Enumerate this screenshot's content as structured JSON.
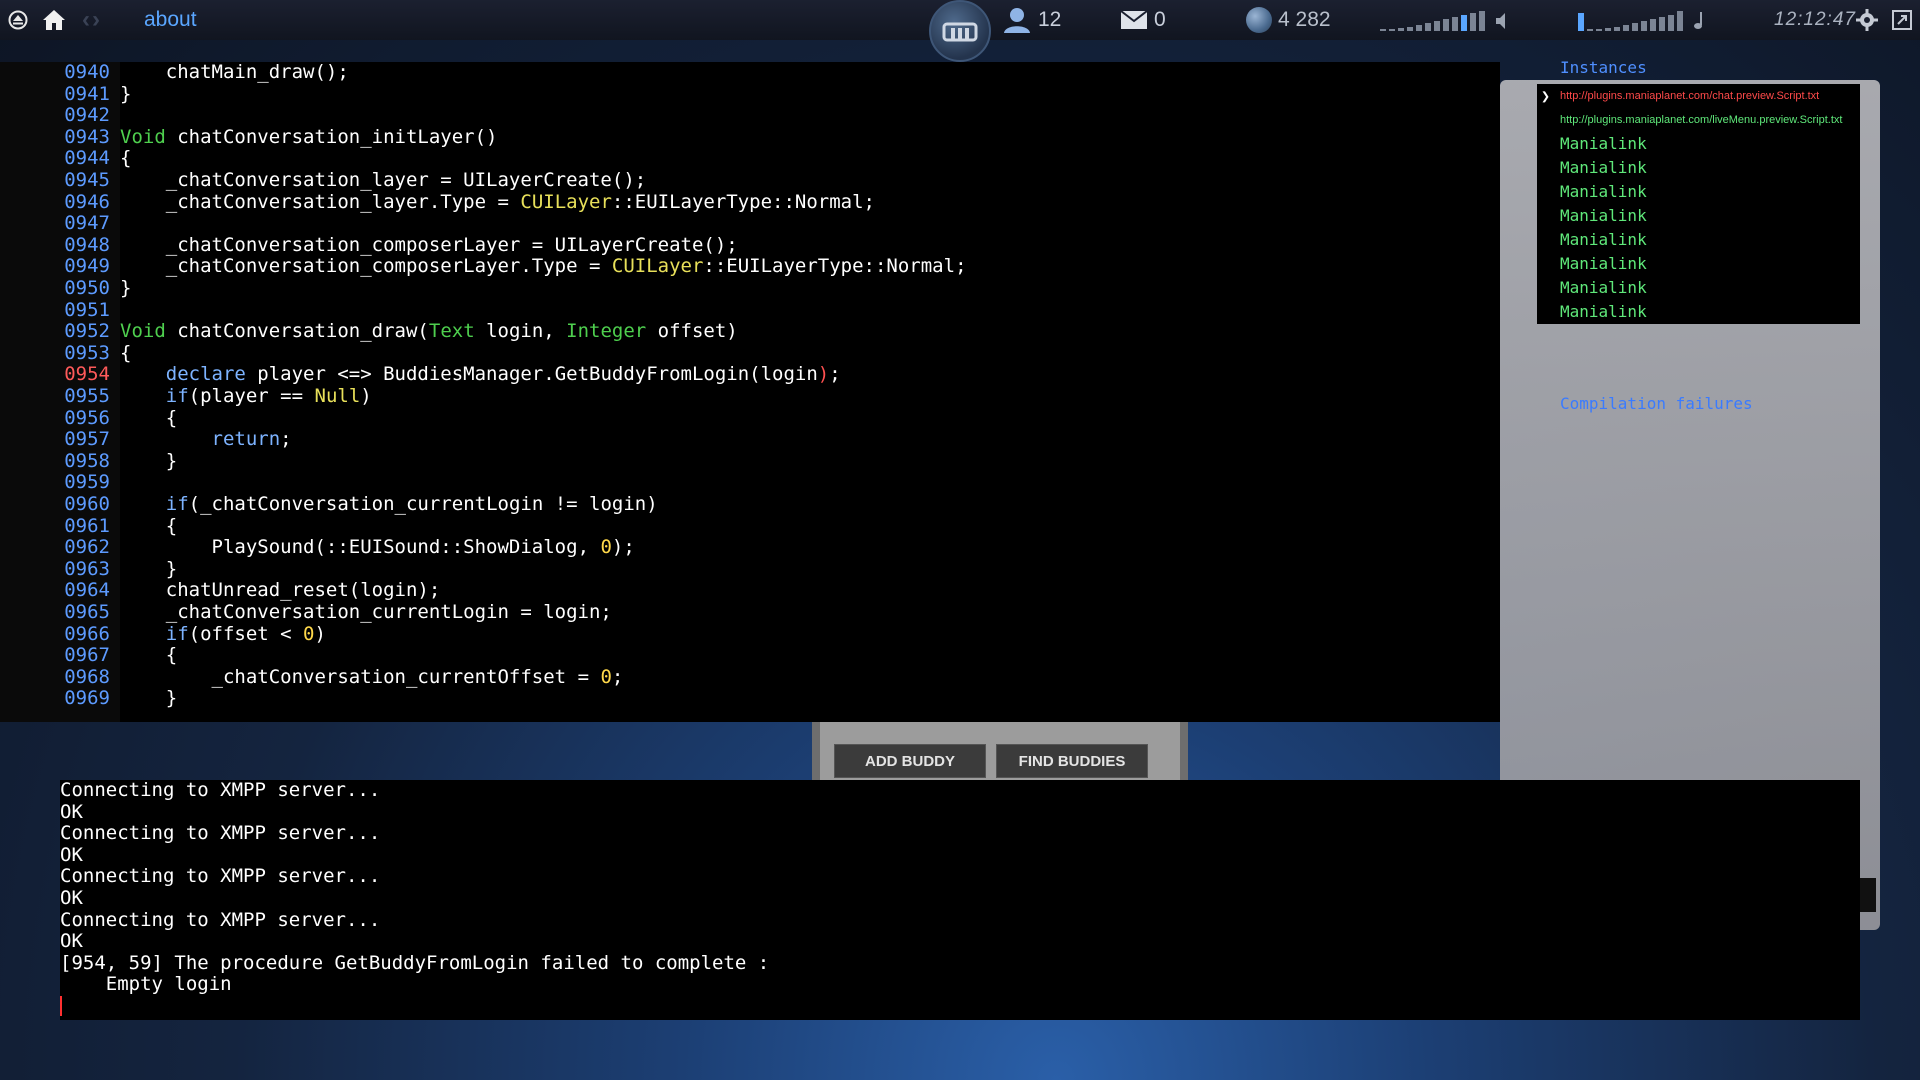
{
  "topbar": {
    "title": "about",
    "friends_count": "12",
    "mail_count": "0",
    "planets": "4 282",
    "clock": "12:12:47",
    "icons": [
      "eject-icon",
      "home-icon",
      "back-arrow-icon",
      "forward-arrow-icon",
      "maniaplanet-logo",
      "buddy-icon",
      "mail-icon",
      "planet-icon",
      "volume-icon",
      "music-volume-icon",
      "gear-icon",
      "fullscreen-icon"
    ]
  },
  "editor": {
    "lines": [
      {
        "n": "0940",
        "text": "    chatMain_draw();"
      },
      {
        "n": "0941",
        "text": "}"
      },
      {
        "n": "0942",
        "text": ""
      },
      {
        "n": "0943",
        "kw": "Void",
        "text": " chatConversation_initLayer()"
      },
      {
        "n": "0944",
        "text": "{"
      },
      {
        "n": "0945",
        "text": "    _chatConversation_layer = UILayerCreate();"
      },
      {
        "n": "0946",
        "pre": "    _chatConversation_layer.Type = ",
        "kwy": "CUILayer",
        "text": "::EUILayerType::Normal;"
      },
      {
        "n": "0947",
        "text": ""
      },
      {
        "n": "0948",
        "text": "    _chatConversation_composerLayer = UILayerCreate();"
      },
      {
        "n": "0949",
        "pre": "    _chatConversation_composerLayer.Type = ",
        "kwy": "CUILayer",
        "text": "::EUILayerType::Normal;"
      },
      {
        "n": "0950",
        "text": "}"
      },
      {
        "n": "0951",
        "text": ""
      },
      {
        "n": "0952",
        "kw": "Void",
        "text": " chatConversation_draw(",
        "kw2": "Text",
        "text2": " login, ",
        "kw3": "Integer",
        "text3": " offset)"
      },
      {
        "n": "0953",
        "text": "{"
      },
      {
        "n": "0954",
        "err": true,
        "pre": "    ",
        "kwb": "declare",
        "text": " player <=> BuddiesManager.GetBuddyFromLogin(login",
        "caret": ")",
        "text2": ";"
      },
      {
        "n": "0955",
        "pre": "    ",
        "kwb": "if",
        "text": "(player == ",
        "kwy2": "Null",
        "text2": ")"
      },
      {
        "n": "0956",
        "text": "    {"
      },
      {
        "n": "0957",
        "pre": "        ",
        "kwb": "return",
        "text": ";"
      },
      {
        "n": "0958",
        "text": "    }"
      },
      {
        "n": "0959",
        "text": ""
      },
      {
        "n": "0960",
        "pre": "    ",
        "kwb": "if",
        "text": "(_chatConversation_currentLogin != login)"
      },
      {
        "n": "0961",
        "text": "    {"
      },
      {
        "n": "0962",
        "pre": "        ",
        "text": "PlaySound(::EUISound::ShowDialog, ",
        "num": "0",
        "text2": ");"
      },
      {
        "n": "0963",
        "text": "    }"
      },
      {
        "n": "0964",
        "text": "    chatUnread_reset(login);"
      },
      {
        "n": "0965",
        "text": "    _chatConversation_currentLogin = login;"
      },
      {
        "n": "0966",
        "pre": "    ",
        "kwb": "if",
        "text": "(offset < ",
        "num": "0",
        "text2": ")"
      },
      {
        "n": "0967",
        "text": "    {"
      },
      {
        "n": "0968",
        "pre": "        ",
        "text": "_chatConversation_currentOffset = ",
        "num": "0",
        "text2": ";"
      },
      {
        "n": "0969",
        "text": "    }"
      }
    ]
  },
  "instances": {
    "title": "Instances",
    "items": [
      {
        "label": "http://plugins.maniaplanet.com/chat.preview.Script.txt",
        "style": "url-red",
        "selected": true
      },
      {
        "label": "http://plugins.maniaplanet.com/liveMenu.preview.Script.txt",
        "style": "url-green",
        "selected": false
      },
      {
        "label": "Manialink",
        "style": "",
        "selected": false
      },
      {
        "label": "Manialink",
        "style": "",
        "selected": false
      },
      {
        "label": "Manialink",
        "style": "",
        "selected": false
      },
      {
        "label": "Manialink",
        "style": "",
        "selected": false
      },
      {
        "label": "Manialink",
        "style": "",
        "selected": false
      },
      {
        "label": "Manialink",
        "style": "",
        "selected": false
      },
      {
        "label": "Manialink",
        "style": "",
        "selected": false
      },
      {
        "label": "Manialink",
        "style": "",
        "selected": false
      }
    ],
    "selected_marker": "❯",
    "compilation_failures": "Compilation failures"
  },
  "buddies": {
    "add_label": "ADD BUDDY",
    "find_label": "FIND BUDDIES"
  },
  "console": {
    "lines": [
      "Connecting to XMPP server...",
      "OK",
      "Connecting to XMPP server...",
      "OK",
      "Connecting to XMPP server...",
      "OK",
      "Connecting to XMPP server...",
      "OK",
      "[954, 59] The procedure GetBuddyFromLogin failed to complete :",
      "    Empty login"
    ]
  }
}
